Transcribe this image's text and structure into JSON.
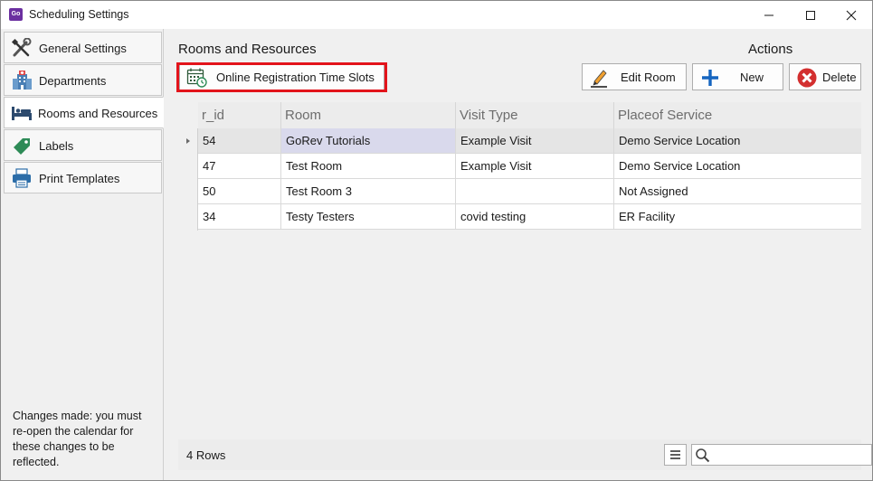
{
  "window": {
    "title": "Scheduling Settings",
    "app_icon_text": "GoRev",
    "minimize_label": "—",
    "maximize_label": "☐",
    "close_label": "✕"
  },
  "sidebar": {
    "items": [
      {
        "label": "General Settings",
        "icon": "tools-icon",
        "active": false
      },
      {
        "label": "Departments",
        "icon": "building-icon",
        "active": false
      },
      {
        "label": "Rooms and Resources",
        "icon": "bed-icon",
        "active": true
      },
      {
        "label": "Labels",
        "icon": "tag-icon",
        "active": false
      },
      {
        "label": "Print Templates",
        "icon": "printer-icon",
        "active": false
      }
    ],
    "note": "Changes made: you must re-open the calendar for these changes to be reflected."
  },
  "main": {
    "section_title": "Rooms and Resources",
    "actions_title": "Actions",
    "online_registration_label": "Online Registration Time Slots",
    "edit_room_label": "Edit Room",
    "new_label": "New",
    "delete_label": "Delete"
  },
  "grid": {
    "columns": [
      "r_id",
      "Room",
      "Visit Type",
      "Placeof Service"
    ],
    "rows": [
      {
        "r_id": "54",
        "room": "GoRev Tutorials",
        "visit_type": "Example Visit",
        "place": "Demo Service Location"
      },
      {
        "r_id": "47",
        "room": "Test Room",
        "visit_type": "Example Visit",
        "place": "Demo Service Location"
      },
      {
        "r_id": "50",
        "room": "Test Room 3",
        "visit_type": "",
        "place": "Not Assigned"
      },
      {
        "r_id": "34",
        "room": "Testy Testers",
        "visit_type": "covid testing",
        "place": "ER Facility"
      }
    ],
    "selected_row": 0,
    "row_count": "4 Rows",
    "search_value": ""
  },
  "colors": {
    "highlight": "#e3141b",
    "delete_red": "#d32f2f",
    "new_blue": "#1565c0",
    "selected_cell": "#d9d9ec"
  }
}
